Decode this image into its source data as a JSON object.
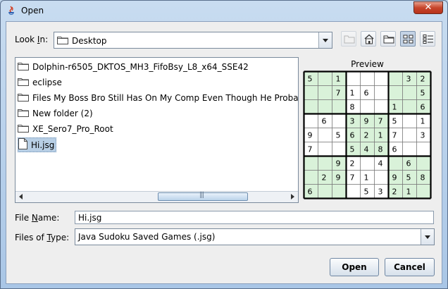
{
  "window": {
    "title": "Open",
    "close_glyph": "✕"
  },
  "look_in": {
    "label_pre": "Look ",
    "label_mnemonic": "I",
    "label_post": "n:",
    "value": "Desktop",
    "icon": "folder-icon"
  },
  "toolbar": {
    "buttons": [
      {
        "name": "up-one-level-button",
        "icon": "folder-up-icon",
        "enabled": false
      },
      {
        "name": "home-button",
        "icon": "home-icon",
        "enabled": true
      },
      {
        "name": "new-folder-button",
        "icon": "new-folder-icon",
        "enabled": true
      },
      {
        "name": "list-view-button",
        "icon": "list-view-icon",
        "enabled": true,
        "active": true
      },
      {
        "name": "details-view-button",
        "icon": "details-view-icon",
        "enabled": true
      }
    ]
  },
  "files": [
    {
      "name": "Dolphin-r6505_DKTOS_MH3_FifoBsy_L8_x64_SSE42",
      "type": "folder"
    },
    {
      "name": "eclipse",
      "type": "folder"
    },
    {
      "name": "Files My Boss Bro Still Has On My Comp Even Though He Probably Do",
      "type": "folder"
    },
    {
      "name": "New folder (2)",
      "type": "folder"
    },
    {
      "name": "XE_Sero7_Pro_Root",
      "type": "folder"
    },
    {
      "name": "Hi.jsg",
      "type": "file",
      "selected": true
    }
  ],
  "preview": {
    "label": "Preview",
    "grid": [
      [
        "5",
        "",
        "1",
        "",
        "",
        "",
        "",
        "3",
        "2"
      ],
      [
        "",
        "",
        "7",
        "1",
        "6",
        "",
        "",
        "",
        "5"
      ],
      [
        "",
        "",
        "",
        "8",
        "",
        "",
        "1",
        "",
        "6"
      ],
      [
        "",
        "6",
        "",
        "3",
        "9",
        "7",
        "5",
        "",
        "1"
      ],
      [
        "9",
        "",
        "5",
        "6",
        "2",
        "1",
        "7",
        "",
        "3"
      ],
      [
        "7",
        "",
        "",
        "5",
        "4",
        "8",
        "6",
        "",
        ""
      ],
      [
        "",
        "",
        "9",
        "2",
        "",
        "4",
        "",
        "6",
        ""
      ],
      [
        "",
        "2",
        "9",
        "7",
        "1",
        "",
        "9",
        "5",
        "8"
      ],
      [
        "6",
        "",
        "",
        "",
        "5",
        "3",
        "2",
        "1",
        ""
      ]
    ],
    "shade_color": "#d9f2d9",
    "shade_boxes": [
      [
        0,
        0
      ],
      [
        0,
        2
      ],
      [
        1,
        1
      ],
      [
        2,
        0
      ],
      [
        2,
        2
      ]
    ]
  },
  "file_name": {
    "label_pre": "File ",
    "label_mnemonic": "N",
    "label_post": "ame:",
    "value": "Hi.jsg"
  },
  "file_type": {
    "label_pre": "Files of ",
    "label_mnemonic": "T",
    "label_post": "ype:",
    "value": "Java Sudoku Saved Games (.jsg)"
  },
  "buttons": {
    "open": "Open",
    "cancel": "Cancel"
  }
}
